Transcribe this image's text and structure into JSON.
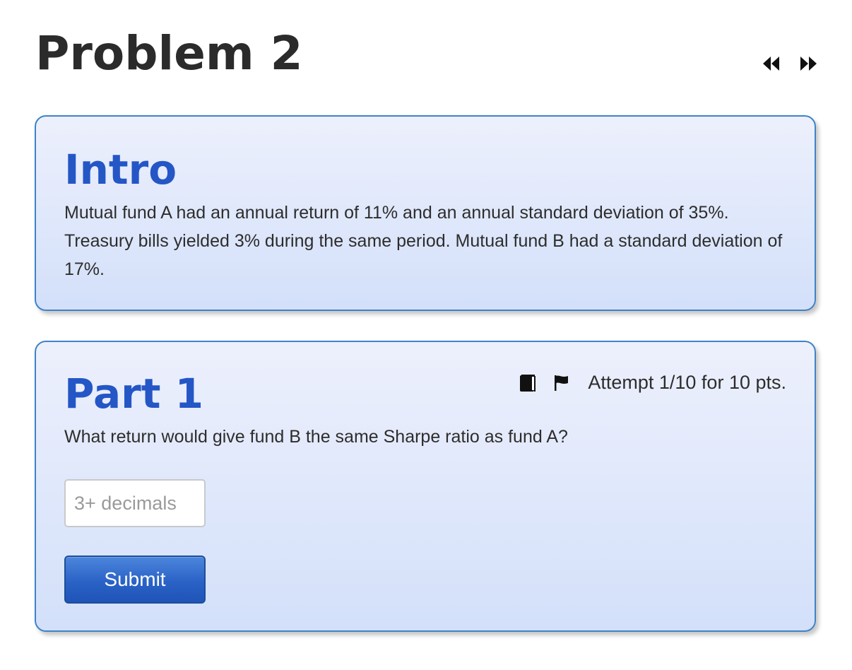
{
  "page": {
    "title": "Problem 2"
  },
  "nav": {
    "prev_icon": "double-chevron-left",
    "next_icon": "double-chevron-right"
  },
  "intro": {
    "heading": "Intro",
    "text": "Mutual fund A had an annual return of 11% and an annual standard deviation of 35%. Treasury bills yielded 3% during the same period. Mutual fund B had a standard deviation of 17%."
  },
  "part1": {
    "heading": "Part 1",
    "book_icon": "book",
    "flag_icon": "flag",
    "attempt_text": "Attempt 1/10 for 10 pts.",
    "question": "What return would give fund B the same Sharpe ratio as fund A?",
    "input": {
      "placeholder": "3+ decimals",
      "value": ""
    },
    "submit_label": "Submit"
  },
  "colors": {
    "heading_blue": "#2456c6",
    "card_border": "#3f83c6",
    "button_blue": "#2a62c6",
    "title_text": "#2b2b2b"
  }
}
